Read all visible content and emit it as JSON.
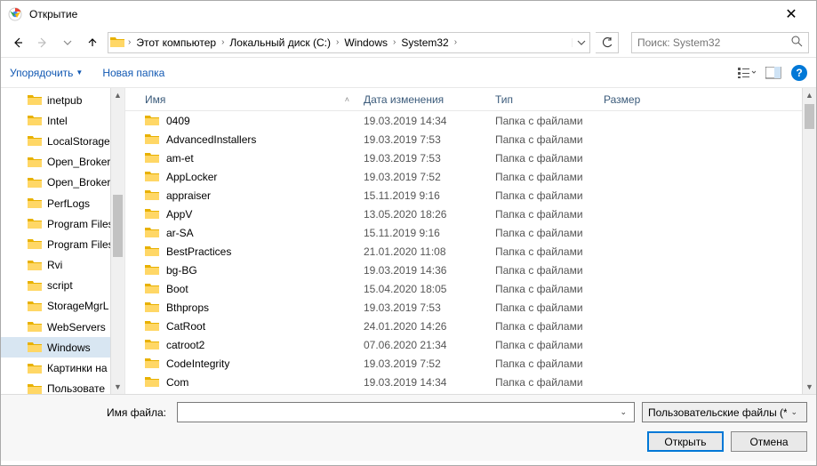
{
  "window": {
    "title": "Открытие"
  },
  "nav": {
    "crumbs": [
      "Этот компьютер",
      "Локальный диск (C:)",
      "Windows",
      "System32"
    ],
    "search_placeholder": "Поиск: System32"
  },
  "toolbar": {
    "organize": "Упорядочить",
    "new_folder": "Новая папка"
  },
  "tree": {
    "items": [
      {
        "label": "inetpub"
      },
      {
        "label": "Intel"
      },
      {
        "label": "LocalStorage"
      },
      {
        "label": "Open_Broker"
      },
      {
        "label": "Open_Broker"
      },
      {
        "label": "PerfLogs"
      },
      {
        "label": "Program Files"
      },
      {
        "label": "Program Files"
      },
      {
        "label": "Rvi"
      },
      {
        "label": "script"
      },
      {
        "label": "StorageMgrL"
      },
      {
        "label": "WebServers"
      },
      {
        "label": "Windows",
        "selected": true
      },
      {
        "label": "Картинки на"
      },
      {
        "label": "Пользовате"
      }
    ]
  },
  "columns": {
    "name": "Имя",
    "date": "Дата изменения",
    "type": "Тип",
    "size": "Размер"
  },
  "files": [
    {
      "name": "0409",
      "date": "19.03.2019 14:34",
      "type": "Папка с файлами"
    },
    {
      "name": "AdvancedInstallers",
      "date": "19.03.2019 7:53",
      "type": "Папка с файлами"
    },
    {
      "name": "am-et",
      "date": "19.03.2019 7:53",
      "type": "Папка с файлами"
    },
    {
      "name": "AppLocker",
      "date": "19.03.2019 7:52",
      "type": "Папка с файлами"
    },
    {
      "name": "appraiser",
      "date": "15.11.2019 9:16",
      "type": "Папка с файлами"
    },
    {
      "name": "AppV",
      "date": "13.05.2020 18:26",
      "type": "Папка с файлами"
    },
    {
      "name": "ar-SA",
      "date": "15.11.2019 9:16",
      "type": "Папка с файлами"
    },
    {
      "name": "BestPractices",
      "date": "21.01.2020 11:08",
      "type": "Папка с файлами"
    },
    {
      "name": "bg-BG",
      "date": "19.03.2019 14:36",
      "type": "Папка с файлами"
    },
    {
      "name": "Boot",
      "date": "15.04.2020 18:05",
      "type": "Папка с файлами"
    },
    {
      "name": "Bthprops",
      "date": "19.03.2019 7:53",
      "type": "Папка с файлами"
    },
    {
      "name": "CatRoot",
      "date": "24.01.2020 14:26",
      "type": "Папка с файлами"
    },
    {
      "name": "catroot2",
      "date": "07.06.2020 21:34",
      "type": "Папка с файлами"
    },
    {
      "name": "CodeIntegrity",
      "date": "19.03.2019 7:52",
      "type": "Папка с файлами"
    },
    {
      "name": "Com",
      "date": "19.03.2019 14:34",
      "type": "Папка с файлами"
    }
  ],
  "footer": {
    "filename_label": "Имя файла:",
    "filename_value": "",
    "filter": "Пользовательские файлы (*.jp",
    "open": "Открыть",
    "cancel": "Отмена"
  }
}
